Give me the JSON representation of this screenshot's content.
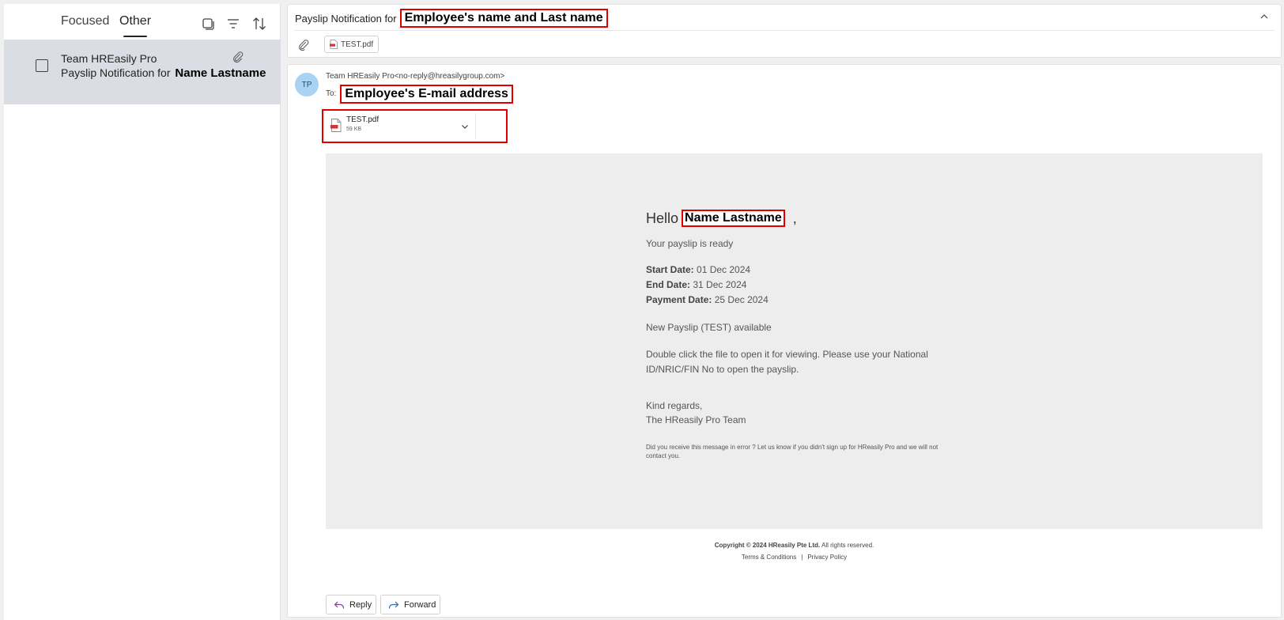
{
  "tabs": {
    "focused": "Focused",
    "other": "Other"
  },
  "mail_list": {
    "items": [
      {
        "sender": "Team HREasily Pro",
        "subject_prefix": "Payslip Notification for",
        "subject_redacted": "Name Lastname",
        "has_attachment": true
      }
    ]
  },
  "reading_header": {
    "subject_prefix": "Payslip Notification for",
    "subject_redacted": "Employee's name and Last name",
    "attachment_chip": "TEST.pdf"
  },
  "message": {
    "avatar_initials": "TP",
    "from": "Team HREasily Pro<no-reply@hreasilygroup.com>",
    "to_label": "To:",
    "to_redacted": "Employee's E-mail address",
    "attachment": {
      "name": "TEST.pdf",
      "size": "59 KB"
    }
  },
  "email_body": {
    "greeting": "Hello",
    "greeting_name_redacted": "Name Lastname",
    "greeting_comma": ",",
    "ready": "Your payslip is ready",
    "start_label": "Start Date:",
    "start_value": "01 Dec 2024",
    "end_label": "End Date:",
    "end_value": "31 Dec 2024",
    "payment_label": "Payment Date:",
    "payment_value": "25 Dec 2024",
    "available": "New Payslip (TEST) available",
    "instructions_line1": "Double click the file to open it for viewing. Please use your National",
    "instructions_line2": "ID/NRIC/FIN No to open the payslip.",
    "regards_line1": "Kind regards,",
    "regards_line2": "The HReasily Pro Team",
    "disclaimer": "Did you receive this message in error ? Let us know if you didn't sign up for HReasily Pro and we will not contact you."
  },
  "footer": {
    "copyright_bold": "Copyright © 2024 HReasily Pte Ltd.",
    "copyright_rest": "All rights reserved.",
    "terms": "Terms & Conditions",
    "separator": "|",
    "privacy": "Privacy Policy"
  },
  "actions": {
    "reply": "Reply",
    "forward": "Forward"
  },
  "colors": {
    "redaction_border": "#e00000",
    "selected_item_bg": "#dadde3",
    "avatar_bg": "#a9d3f2",
    "email_body_bg": "#ededed"
  },
  "icons": [
    "select-all-icon",
    "filter-icon",
    "sort-icon",
    "attachment-icon",
    "collapse-icon",
    "pdf-file-icon",
    "chevron-down-icon",
    "reply-icon",
    "forward-icon"
  ]
}
